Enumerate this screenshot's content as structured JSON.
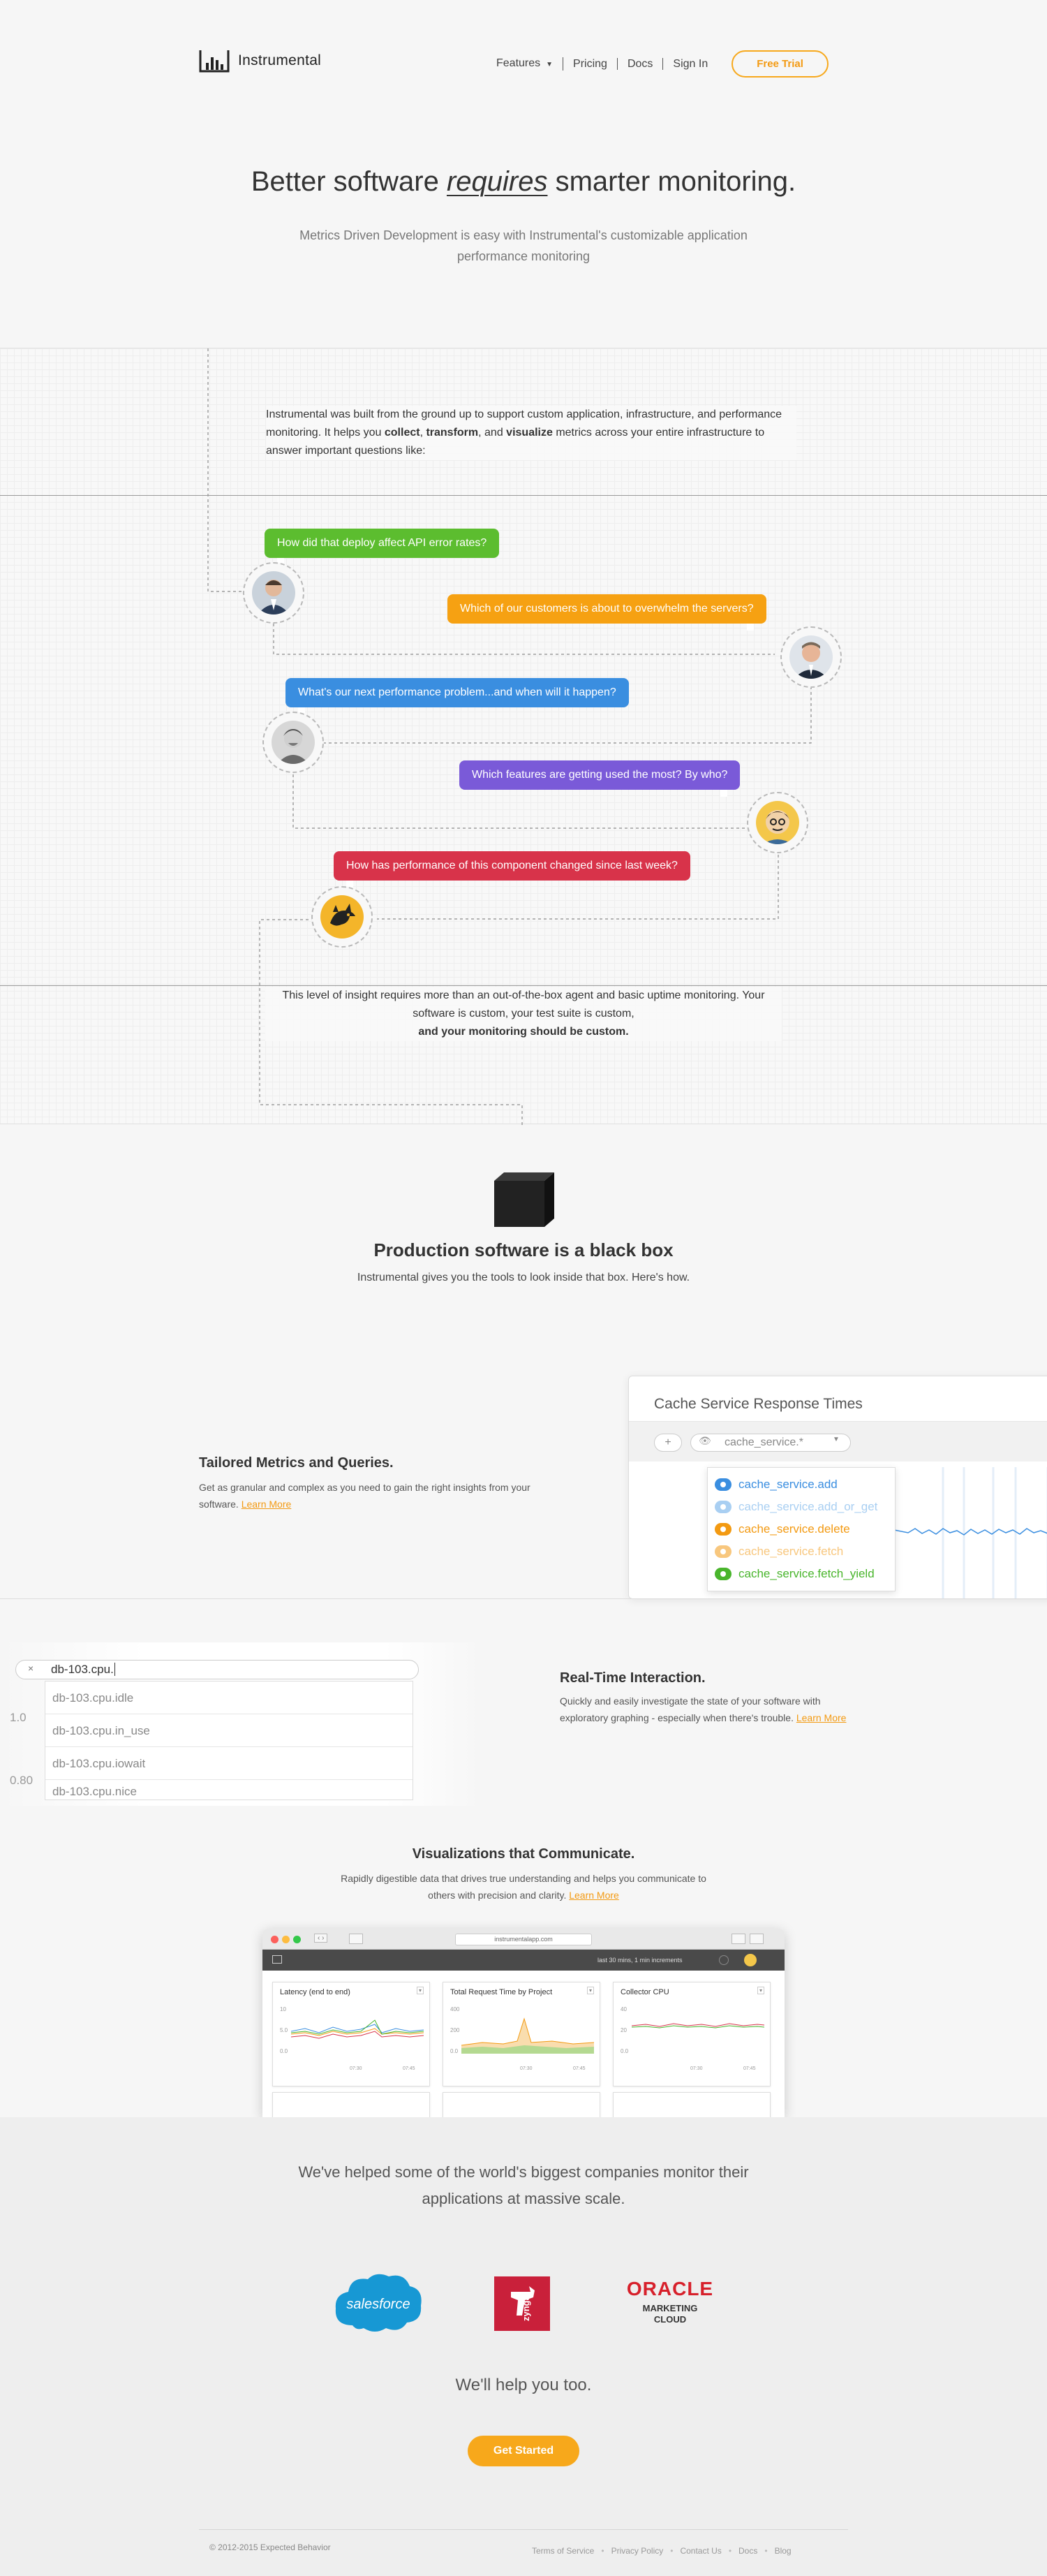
{
  "brand": {
    "name": "Instrumental"
  },
  "nav": {
    "items": [
      "Features",
      "Pricing",
      "Docs",
      "Sign In"
    ],
    "trial_label": "Free Trial"
  },
  "hero": {
    "title_pre": "Better software ",
    "title_em": "requires",
    "title_post": " smarter monitoring.",
    "subtitle": "Metrics Driven Development is easy with Instrumental's customizable application performance monitoring"
  },
  "intro": {
    "p1": "Instrumental was built from the ground up to support custom application, infrastructure, and performance monitoring. It helps you ",
    "collect": "collect",
    "comma": ", ",
    "transform": "transform",
    "and": ", and ",
    "visualize": "visualize",
    "p2": " metrics across your entire infrastructure to answer important questions like:"
  },
  "questions": [
    {
      "text": "How did that deploy affect API error rates?",
      "color": "#5cbd2f"
    },
    {
      "text": "Which of our customers is about to overwhelm the servers?",
      "color": "#f6a112"
    },
    {
      "text": "What's our next performance problem...and when will it happen?",
      "color": "#3a8ee0"
    },
    {
      "text": "Which features are getting used the most? By who?",
      "color": "#7a5ad8"
    },
    {
      "text": "How has performance of this component changed since last week?",
      "color": "#d8334a"
    }
  ],
  "outro": {
    "line1": "This level of insight requires more than an out-of-the-box agent and basic uptime monitoring. Your software is custom, your test suite is custom,",
    "line2": "and your monitoring should be custom."
  },
  "blackbox": {
    "title": "Production software is a black box",
    "subtitle": "Instrumental gives you the tools to look inside that box. Here's how."
  },
  "feature1": {
    "title": "Tailored Metrics and Queries.",
    "body": "Get as granular and complex as you need to gain the right insights from your software. ",
    "link": "Learn More"
  },
  "cache_card": {
    "title": "Cache Service Response Times",
    "plus": "+",
    "query": "cache_service.*",
    "items": [
      {
        "label": "cache_service.add",
        "color": "#3a8ee0"
      },
      {
        "label": "cache_service.add_or_get",
        "color": "#a9cff2"
      },
      {
        "label": "cache_service.delete",
        "color": "#f39a12"
      },
      {
        "label": "cache_service.fetch",
        "color": "#f8c77e"
      },
      {
        "label": "cache_service.fetch_yield",
        "color": "#49b52c"
      }
    ]
  },
  "feature2": {
    "title": "Real-Time Interaction.",
    "body": "Quickly and easily investigate the state of your software with exploratory graphing - especially when there's trouble. ",
    "link": "Learn More"
  },
  "realtime": {
    "x_icon": "×",
    "query": "db-103.cpu.",
    "items": [
      "db-103.cpu.idle",
      "db-103.cpu.in_use",
      "db-103.cpu.iowait",
      "db-103.cpu.nice"
    ],
    "axis": [
      "1.0",
      "0.80"
    ]
  },
  "feature3": {
    "title": "Visualizations that Communicate.",
    "body": "Rapidly digestible data that drives true understanding and helps you communicate to others with precision and clarity. ",
    "link": "Learn More"
  },
  "browser": {
    "url": "instrumentalapp.com",
    "time_info": "last 30 mins, 1 min increments",
    "panels": [
      "Latency (end to end)",
      "Total Request Time by Project",
      "Collector CPU"
    ],
    "panel_axes": [
      [
        "10",
        "5.0",
        "0.0"
      ],
      [
        "400",
        "200",
        "0.0"
      ],
      [
        "40",
        "20",
        "0.0"
      ]
    ],
    "panel_x": [
      [
        "07:30",
        "07:45"
      ],
      [
        "07:30",
        "07:45"
      ],
      [
        "07:30",
        "07:45"
      ]
    ]
  },
  "customers": {
    "headline": "We've helped some of the world's biggest companies monitor their applications at massive scale.",
    "logos": {
      "salesforce": "salesforce",
      "zynga": "zynga",
      "oracle": "ORACLE",
      "oracle_sub": "MARKETING CLOUD"
    },
    "help": "We'll help you too.",
    "cta": "Get Started"
  },
  "footer": {
    "copyright": "© 2012-2015 Expected Behavior",
    "links": [
      "Terms of Service",
      "Privacy Policy",
      "Contact Us",
      "Docs",
      "Blog"
    ]
  }
}
